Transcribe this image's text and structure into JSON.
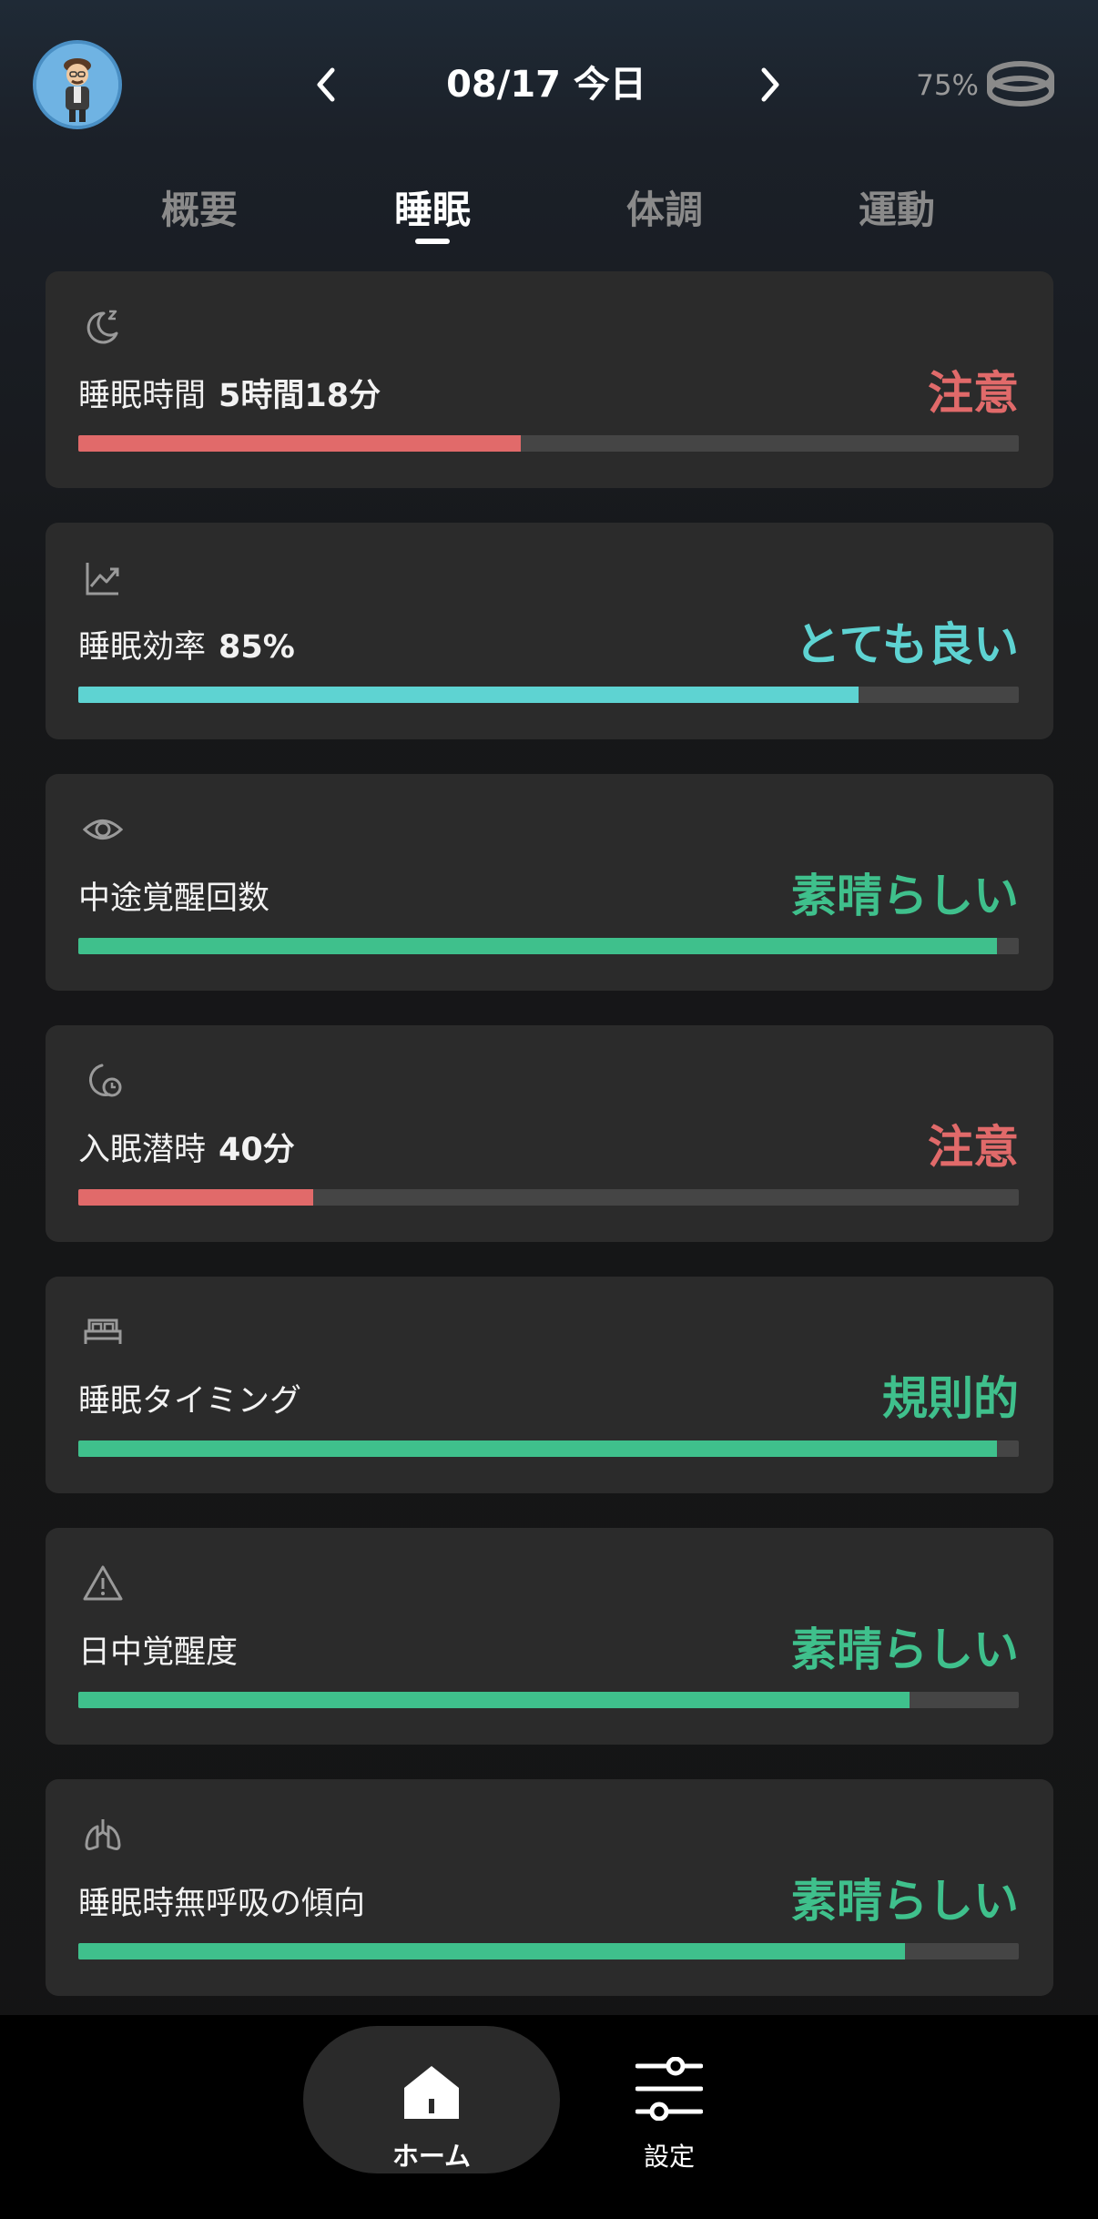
{
  "header": {
    "date_label": "08/17 今日",
    "battery_percent": "75%"
  },
  "tabs": [
    {
      "label": "概要",
      "active": false
    },
    {
      "label": "睡眠",
      "active": true
    },
    {
      "label": "体調",
      "active": false
    },
    {
      "label": "運動",
      "active": false
    }
  ],
  "colors": {
    "warning": "#e16a6a",
    "good": "#5ed3d2",
    "great": "#3fc08c",
    "track": "#454545",
    "card": "#2b2b2b"
  },
  "cards": [
    {
      "icon": "moon-sleep-icon",
      "label": "睡眠時間",
      "value": "5時間18分",
      "status": "注意",
      "status_color": "#e16a6a",
      "progress": 0.47
    },
    {
      "icon": "trend-chart-icon",
      "label": "睡眠効率",
      "value": "85%",
      "status": "とても良い",
      "status_color": "#5ed3d2",
      "progress": 0.83
    },
    {
      "icon": "eye-icon",
      "label": "中途覚醒回数",
      "value": "",
      "status": "素晴らしい",
      "status_color": "#3fc08c",
      "progress": 0.977
    },
    {
      "icon": "moon-clock-icon",
      "label": "入眠潜時",
      "value": "40分",
      "status": "注意",
      "status_color": "#e16a6a",
      "progress": 0.25
    },
    {
      "icon": "bed-icon",
      "label": "睡眠タイミング",
      "value": "",
      "status": "規則的",
      "status_color": "#3fc08c",
      "progress": 0.977
    },
    {
      "icon": "warning-triangle-icon",
      "label": "日中覚醒度",
      "value": "",
      "status": "素晴らしい",
      "status_color": "#3fc08c",
      "progress": 0.884
    },
    {
      "icon": "lungs-icon",
      "label": "睡眠時無呼吸の傾向",
      "value": "",
      "status": "素晴らしい",
      "status_color": "#3fc08c",
      "progress": 0.879
    }
  ],
  "bottom_nav": {
    "home_label": "ホーム",
    "settings_label": "設定"
  }
}
